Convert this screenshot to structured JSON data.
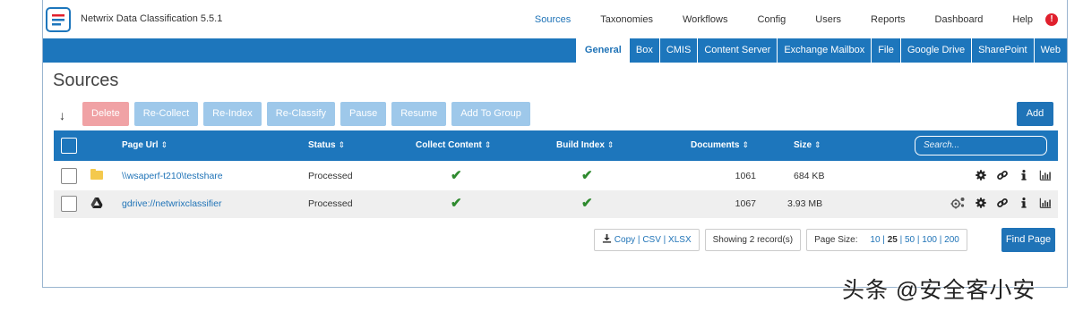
{
  "app": {
    "title": "Netwrix Data Classification 5.5.1"
  },
  "topnav": [
    "Sources",
    "Taxonomies",
    "Workflows",
    "Config",
    "Users",
    "Reports",
    "Dashboard",
    "Help"
  ],
  "alert_badge": "!",
  "subnav": [
    "General",
    "Box",
    "CMIS",
    "Content Server",
    "Exchange Mailbox",
    "File",
    "Google Drive",
    "SharePoint",
    "Web"
  ],
  "page_title": "Sources",
  "toolbar": {
    "sort_glyph": "↓",
    "buttons": [
      "Delete",
      "Re-Collect",
      "Re-Index",
      "Re-Classify",
      "Pause",
      "Resume",
      "Add To Group"
    ],
    "add_label": "Add"
  },
  "table": {
    "headers": {
      "page_url": "Page Url",
      "status": "Status",
      "collect_content": "Collect Content",
      "build_index": "Build Index",
      "documents": "Documents",
      "size": "Size",
      "sort_glyph": "⇕"
    },
    "search_placeholder": "Search...",
    "rows": [
      {
        "icon": "folder-icon",
        "url": "\\\\wsaperf-t210\\testshare",
        "status": "Processed",
        "collect": "✔",
        "index": "✔",
        "documents": "1061",
        "size": "684 KB"
      },
      {
        "icon": "google-drive-icon",
        "url": "gdrive://netwrixclassifier",
        "status": "Processed",
        "collect": "✔",
        "index": "✔",
        "documents": "1067",
        "size": "3.93 MB"
      }
    ]
  },
  "footer": {
    "export_icon": "download-icon",
    "copy": "Copy",
    "csv": "CSV",
    "xlsx": "XLSX",
    "sep": "|",
    "records": "Showing 2 record(s)",
    "page_size_label": "Page Size:",
    "page_sizes": [
      "10",
      "25",
      "50",
      "100",
      "200"
    ],
    "page_size_selected": "25",
    "find_page": "Find Page"
  },
  "watermark": "头条 @安全客小安",
  "colors": {
    "brand_blue": "#1d76bc",
    "link_blue": "#1f73b7",
    "danger_light": "#f0a2a5",
    "disabled_blue": "#9ec8ea",
    "check_green": "#2e8a2e",
    "alert_red": "#e0202d"
  }
}
